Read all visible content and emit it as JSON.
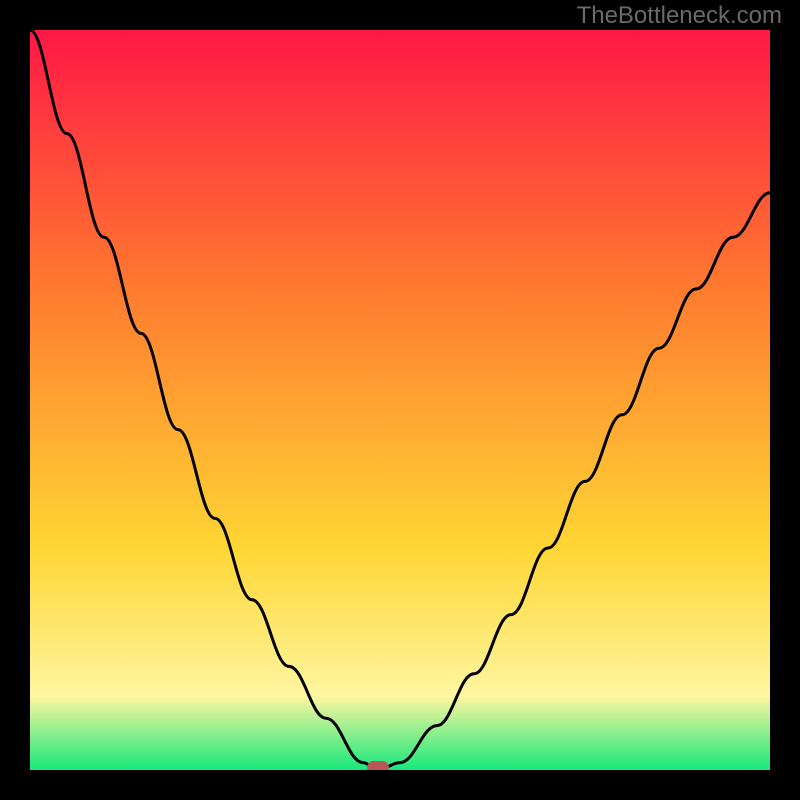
{
  "watermark": "TheBottleneck.com",
  "colors": {
    "background_black": "#000000",
    "gradient_top": "#ff1846",
    "gradient_mid1": "#ff7a2f",
    "gradient_mid2": "#ffd634",
    "gradient_low": "#fff6a0",
    "gradient_bottom": "#17e87b",
    "curve": "#000000",
    "marker": "#b85757",
    "watermark_text": "#6a6a6a"
  },
  "chart_data": {
    "type": "line",
    "title": "",
    "xlabel": "",
    "ylabel": "",
    "xlim": [
      0,
      100
    ],
    "ylim": [
      0,
      100
    ],
    "grid": false,
    "legend": false,
    "axes_visible": false,
    "background": "rainbow-vertical-gradient (red→orange→yellow→green)",
    "series": [
      {
        "name": "bottleneck-curve",
        "x": [
          0,
          5,
          10,
          15,
          20,
          25,
          30,
          35,
          40,
          45,
          47,
          50,
          55,
          60,
          65,
          70,
          75,
          80,
          85,
          90,
          95,
          100
        ],
        "values": [
          100,
          86,
          72,
          59,
          46,
          34,
          23,
          14,
          7,
          1,
          0,
          1,
          6,
          13,
          21,
          30,
          39,
          48,
          57,
          65,
          72,
          78
        ]
      }
    ],
    "annotations": [
      {
        "name": "optimal-marker",
        "shape": "rounded-rect",
        "x": 47,
        "y": 0,
        "color": "#b85757"
      }
    ]
  }
}
